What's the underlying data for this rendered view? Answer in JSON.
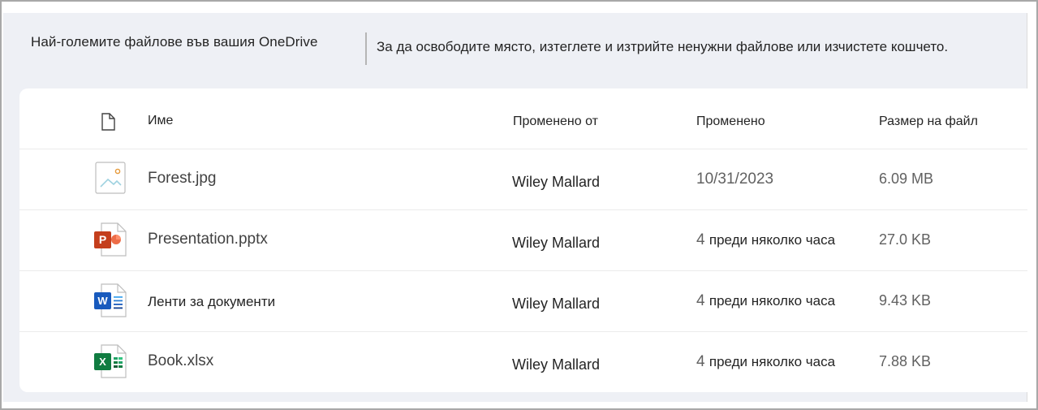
{
  "header": {
    "title": "Най-големите файлове във вашия OneDrive",
    "description": "За да освободите място, изтеглете и изтрийте ненужни файлове или изчистете кошчето."
  },
  "table": {
    "columns": {
      "name": "Име",
      "modified_by": "Променено от",
      "modified": "Променено",
      "size": "Размер на файл"
    },
    "rows": [
      {
        "icon": "image-file-icon",
        "name": "Forest.jpg",
        "modified_by": "Wiley Mallard",
        "modified_num": "",
        "modified_text": "10/31/2023",
        "size": "6.09 MB"
      },
      {
        "icon": "powerpoint-file-icon",
        "name": "Presentation.pptx",
        "modified_by": "Wiley Mallard",
        "modified_num": "4",
        "modified_text": "преди няколко часа",
        "size": "27.0 KB"
      },
      {
        "icon": "word-file-icon",
        "name": "Ленти за документи",
        "modified_by": "Wiley Mallard",
        "modified_num": "4",
        "modified_text": "преди няколко часа",
        "size": "9.43 KB"
      },
      {
        "icon": "excel-file-icon",
        "name": "Book.xlsx",
        "modified_by": "Wiley Mallard",
        "modified_num": "4",
        "modified_text": "преди няколко часа",
        "size": "7.88 KB"
      }
    ],
    "icon_glyphs": {
      "powerpoint": "P",
      "word": "W",
      "excel": "X"
    }
  },
  "colors": {
    "powerpoint": "#c43e1c",
    "word": "#185abd",
    "excel": "#107c41",
    "panel": "#eef0f5"
  }
}
